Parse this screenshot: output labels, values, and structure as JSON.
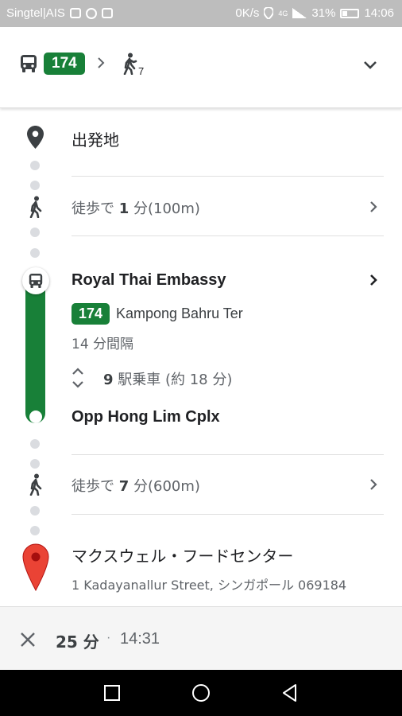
{
  "status_bar": {
    "carrier": "Singtel|AIS",
    "speed": "0K/s",
    "network": "4G",
    "battery": "31%",
    "time": "14:06"
  },
  "header": {
    "route_number": "174",
    "walk_count": "7",
    "icons": [
      "bus-icon",
      "chevron-right-icon",
      "walk-icon",
      "chevron-down-icon"
    ]
  },
  "steps": {
    "origin": "出発地",
    "walk1": {
      "prefix": "徒歩で ",
      "minutes": "1",
      "suffix": " 分(100m)"
    },
    "board_stop": "Royal Thai Embassy",
    "route_badge": "174",
    "headsign": "Kampong Bahru Ter",
    "frequency": "14 分間隔",
    "ride": {
      "stops": "9",
      "text": " 駅乗車 (約 18 分)"
    },
    "alight_stop": "Opp Hong Lim Cplx",
    "walk2": {
      "prefix": "徒歩で ",
      "minutes": "7",
      "suffix": " 分(600m)"
    },
    "destination": "マクスウェル・フードセンター",
    "address": "1 Kadayanallur Street, シンガポール 069184"
  },
  "summary": {
    "duration": "25 分",
    "separator": "·",
    "arrival": "14:31"
  },
  "colors": {
    "transit_green": "#188038",
    "pin_red": "#ea4335",
    "dot_grey": "#dadce0"
  }
}
